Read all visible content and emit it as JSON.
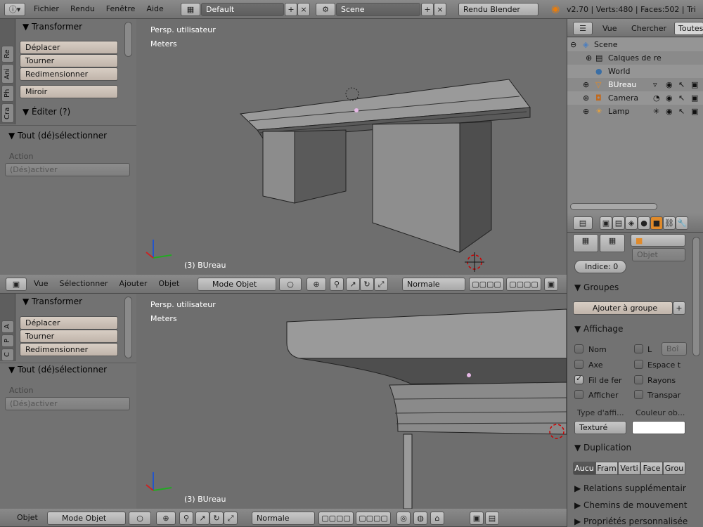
{
  "top_menu": {
    "items": [
      "Fichier",
      "Rendu",
      "Fenêtre",
      "Aide"
    ],
    "layout": "Default",
    "scene": "Scene",
    "engine": "Rendu Blender",
    "stats": "v2.70 | Verts:480 | Faces:502 | Tri"
  },
  "left_panel_top": {
    "tabs": [
      "Re",
      "Ani",
      "Ph",
      "Cra"
    ],
    "transform_title": "▼ Transformer",
    "buttons": [
      "Déplacer",
      "Tourner",
      "Redimensionner"
    ],
    "mirror": "Miroir",
    "edit_title": "▼ Éditer (?)",
    "toggle_title": "▼ Tout (dé)sélectionner",
    "action_label": "Action",
    "action_value": "(Dés)activer"
  },
  "left_panel_bottom": {
    "tabs": [
      "A",
      "P",
      "C"
    ],
    "transform_title": "▼ Transformer",
    "buttons": [
      "Déplacer",
      "Tourner",
      "Redimensionner"
    ],
    "toggle_title": "▼ Tout (dé)sélectionner",
    "action_label": "Action",
    "action_value": "(Dés)activer"
  },
  "viewport_top": {
    "view_name": "Persp. utilisateur",
    "units": "Meters",
    "object_label": "(3) BUreau"
  },
  "viewport_bottom": {
    "view_name": "Persp. utilisateur",
    "units": "Meters",
    "object_label": "(3) BUreau"
  },
  "header_mid": {
    "menus": [
      "Vue",
      "Sélectionner",
      "Ajouter",
      "Objet"
    ],
    "mode": "Mode Objet",
    "orientation": "Normale"
  },
  "header_bottom": {
    "menus": [
      "Objet"
    ],
    "mode": "Mode Objet",
    "orientation": "Normale"
  },
  "outliner": {
    "tabs": [
      "Vue",
      "Chercher",
      "Toutes"
    ],
    "rows": [
      {
        "label": "Scene",
        "indent": 0
      },
      {
        "label": "Calques de re",
        "indent": 1
      },
      {
        "label": "World",
        "indent": 1
      },
      {
        "label": "BUreau",
        "indent": 1
      },
      {
        "label": "Camera",
        "indent": 1
      },
      {
        "label": "Lamp",
        "indent": 1
      }
    ]
  },
  "properties": {
    "object_type": "Objet",
    "index": "Indice: 0",
    "groups_title": "▼ Groupes",
    "add_group": "Ajouter à groupe",
    "display_title": "▼ Affichage",
    "checks": [
      {
        "label": "Nom",
        "on": false
      },
      {
        "label": "L",
        "on": false
      },
      {
        "label": "Axe",
        "on": false
      },
      {
        "label": "Espace t",
        "on": false
      },
      {
        "label": "Fil de fer",
        "on": true
      },
      {
        "label": "Rayons",
        "on": false
      },
      {
        "label": "Afficher",
        "on": false
      },
      {
        "label": "Transpar",
        "on": false
      }
    ],
    "bounds_field": "Boî",
    "display_type_label": "Type d'affi...",
    "obj_color_label": "Couleur ob...",
    "display_type_value": "Texturé",
    "duplication_title": "▼ Duplication",
    "dup_options": [
      "Aucu",
      "Fram",
      "Verti",
      "Face",
      "Grou"
    ],
    "collapsed": [
      "▶ Relations supplémentair",
      "▶ Chemins de mouvement",
      "▶ Propriétés personnalisée"
    ]
  }
}
